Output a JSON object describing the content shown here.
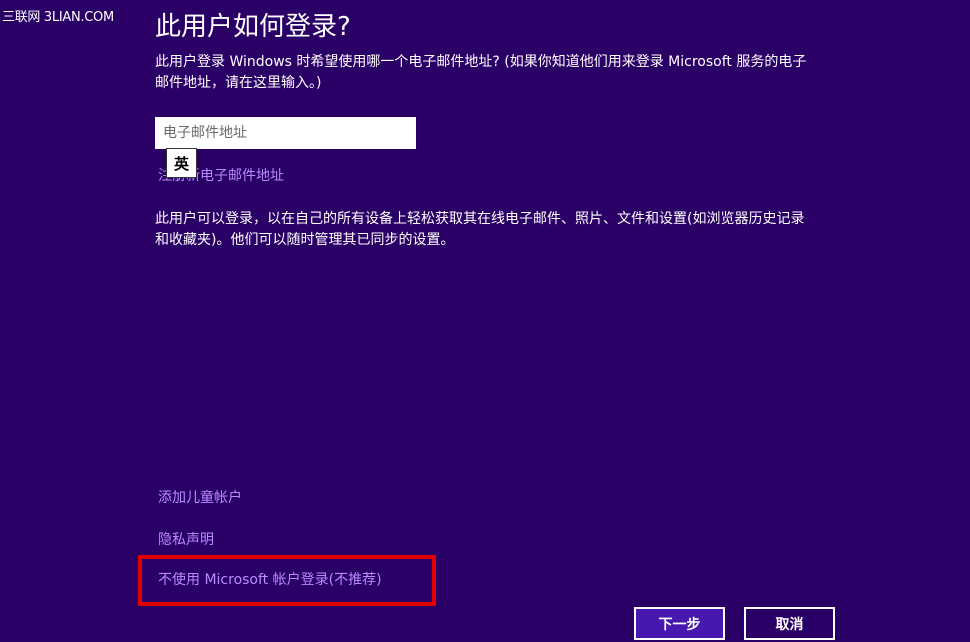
{
  "watermark": "三联网 3LIAN.COM",
  "page_title": "此用户如何登录?",
  "intro_text": "此用户登录 Windows 时希望使用哪一个电子邮件地址? (如果你知道他们用来登录 Microsoft 服务的电子邮件地址，请在这里输入。)",
  "email_field": {
    "value": "",
    "placeholder": "电子邮件地址"
  },
  "ime_indicator": "英",
  "signup_link": "注册新电子邮件地址",
  "description_text": "此用户可以登录，以在自己的所有设备上轻松获取其在线电子邮件、照片、文件和设置(如浏览器历史记录和收藏夹)。他们可以随时管理其已同步的设置。",
  "links": {
    "add_child": "添加儿童帐户",
    "privacy": "隐私声明",
    "local_account": "不使用 Microsoft 帐户登录(不推荐)"
  },
  "buttons": {
    "next": "下一步",
    "cancel": "取消"
  },
  "colors": {
    "background": "#2a0066",
    "link": "#b48cff",
    "primary_button": "#4618b0",
    "highlight": "#e00000"
  }
}
